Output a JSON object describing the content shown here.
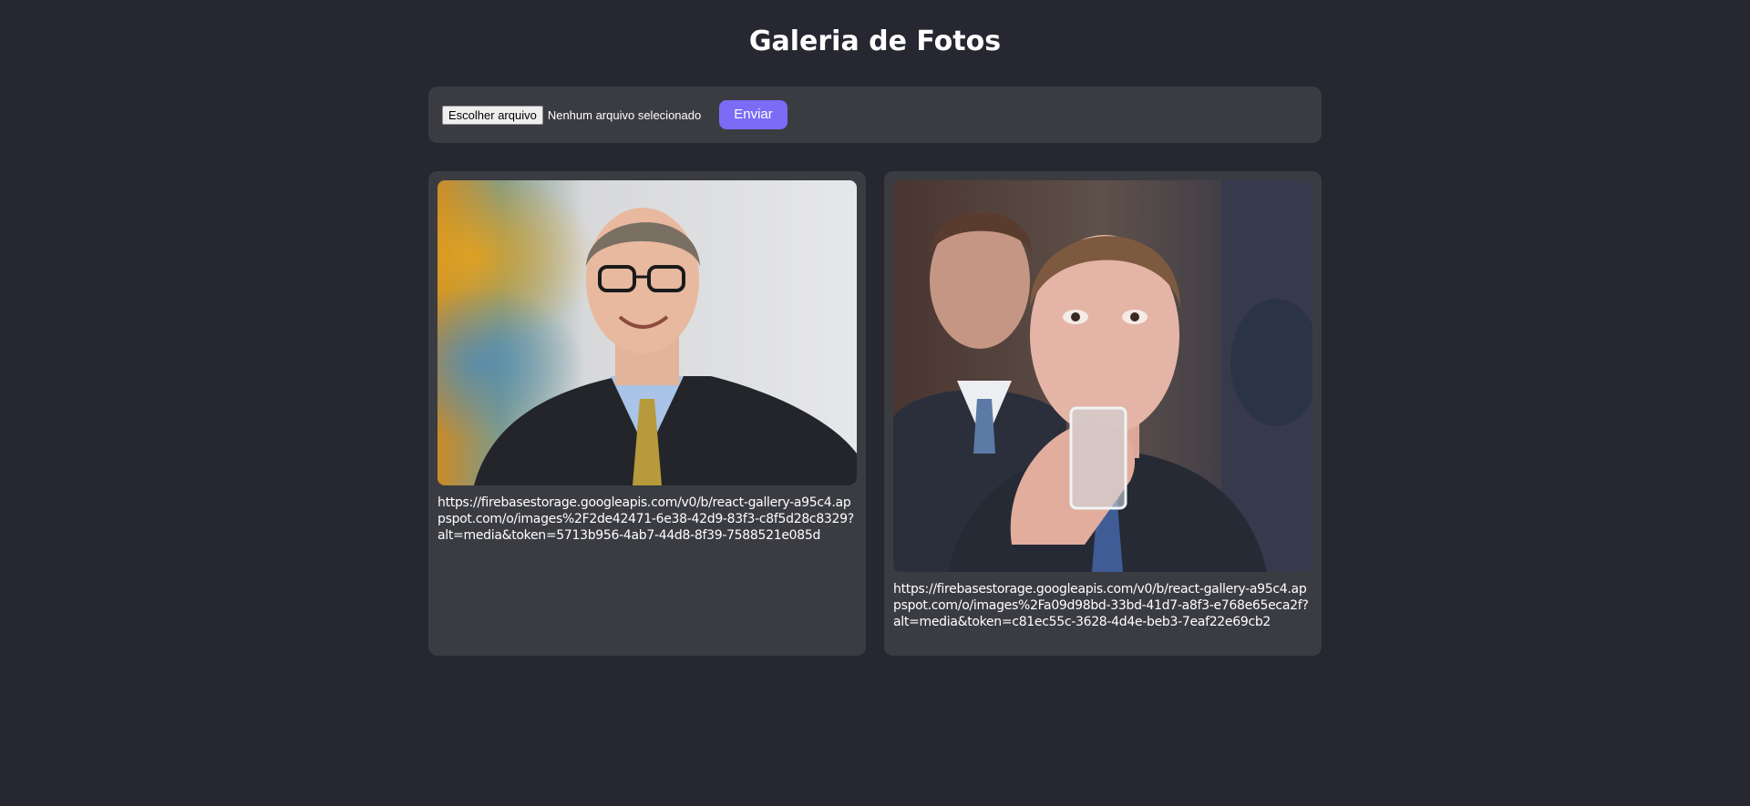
{
  "header": {
    "title": "Galeria de Fotos"
  },
  "upload": {
    "choose_label": "Escolher arquivo",
    "status_text": "Nenhum arquivo selecionado",
    "send_label": "Enviar"
  },
  "gallery": {
    "items": [
      {
        "url": "https://firebasestorage.googleapis.com/v0/b/react-gallery-a95c4.appspot.com/o/images%2F2de42471-6e38-42d9-83f3-c8f5d28c8329?alt=media&token=5713b956-4ab7-44d8-8f39-7588521e085d"
      },
      {
        "url": "https://firebasestorage.googleapis.com/v0/b/react-gallery-a95c4.appspot.com/o/images%2Fa09d98bd-33bd-41d7-a8f3-e768e65eca2f?alt=media&token=c81ec55c-3628-4d4e-beb3-7eaf22e69cb2"
      }
    ]
  },
  "colors": {
    "background": "#262730",
    "panel": "#3b3c42",
    "accent": "#7b6cf6"
  }
}
